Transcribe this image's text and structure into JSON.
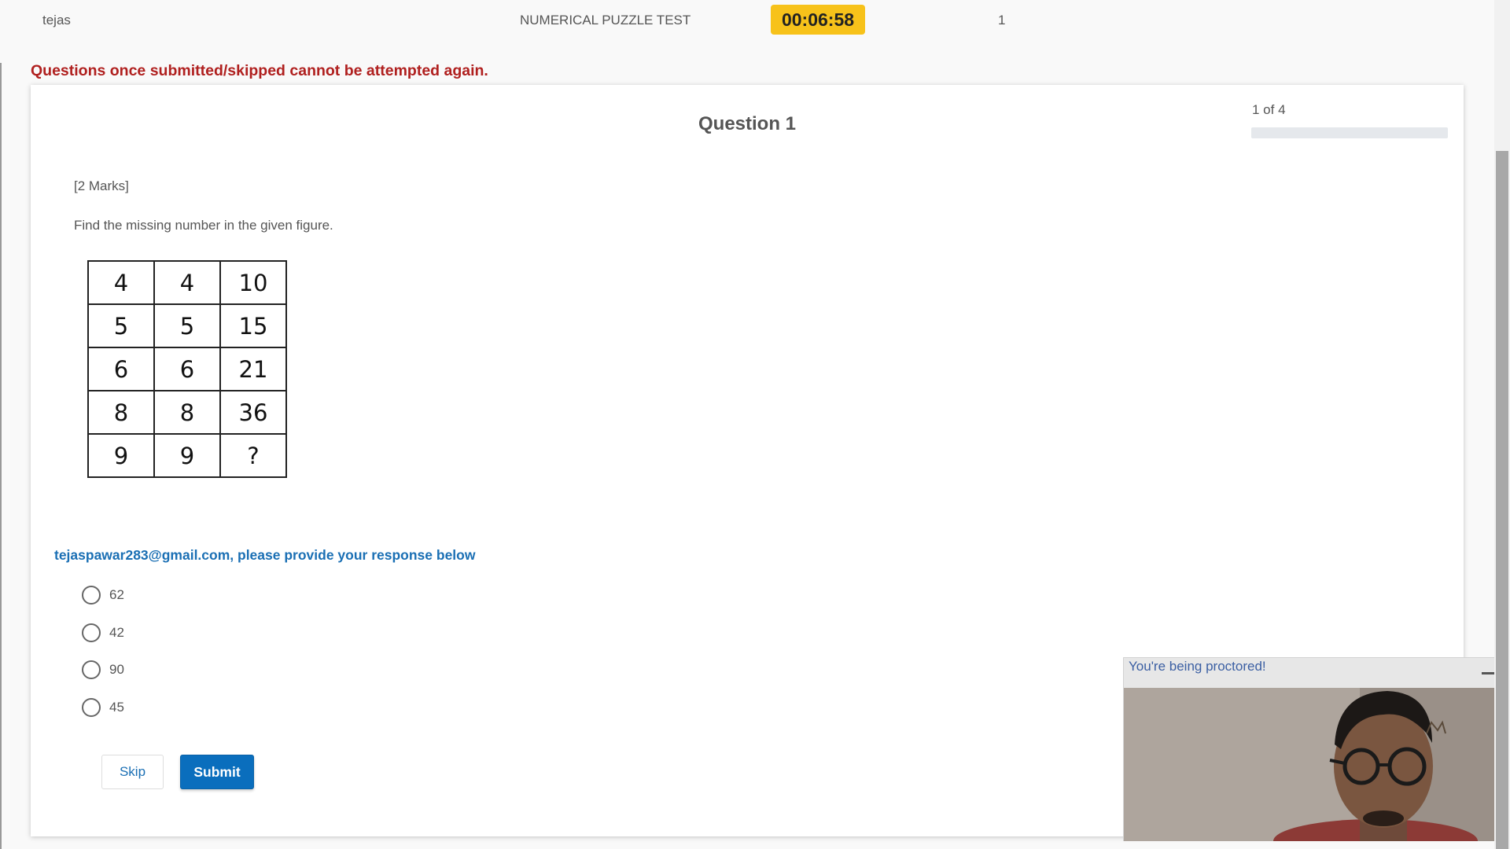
{
  "header": {
    "user_name": "tejas",
    "test_title": "NUMERICAL PUZZLE TEST",
    "timer": "00:06:58",
    "question_number": "1"
  },
  "warning": "Questions once submitted/skipped cannot be attempted again.",
  "question": {
    "title": "Question 1",
    "progress_label": "1 of 4",
    "progress_fraction": 0,
    "marks": "[2 Marks]",
    "text": "Find the missing number in the given figure.",
    "puzzle_grid": [
      [
        "4",
        "4",
        "10"
      ],
      [
        "5",
        "5",
        "15"
      ],
      [
        "6",
        "6",
        "21"
      ],
      [
        "8",
        "8",
        "36"
      ],
      [
        "9",
        "9",
        "?"
      ]
    ]
  },
  "response": {
    "prompt": "tejaspawar283@gmail.com, please provide your response below",
    "options": [
      "62",
      "42",
      "90",
      "45"
    ],
    "selected": null
  },
  "actions": {
    "skip_label": "Skip",
    "submit_label": "Submit"
  },
  "proctor": {
    "text": "You're being proctored!"
  },
  "colors": {
    "timer_bg": "#f7c21a",
    "warning_text": "#b0201f",
    "accent_blue": "#0a6ebd",
    "prompt_blue": "#1a6fb4",
    "proctor_text": "#3b5fa3"
  }
}
